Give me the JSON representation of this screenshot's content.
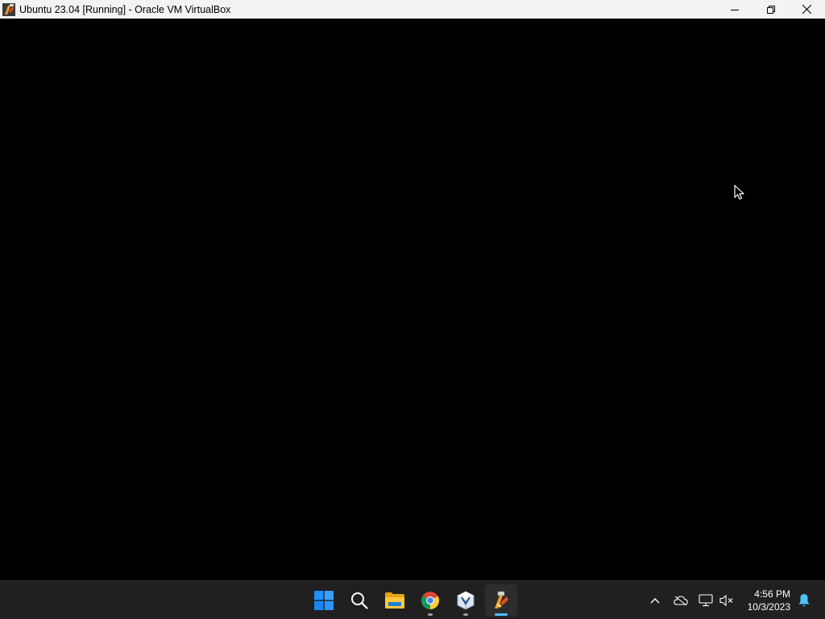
{
  "window": {
    "title": "Ubuntu 23.04 [Running] - Oracle VM VirtualBox",
    "icon": "virtualbox-vm-icon",
    "controls": [
      "minimize-icon",
      "restore-icon",
      "close-icon"
    ]
  },
  "vm_display": {
    "content": "",
    "background": "#000000"
  },
  "taskbar": {
    "background": "#202020",
    "pinned": [
      {
        "name": "start",
        "icon": "windows-logo-icon",
        "running": false,
        "active": false
      },
      {
        "name": "search",
        "icon": "search-icon",
        "running": false,
        "active": false
      },
      {
        "name": "file-explorer",
        "icon": "folder-icon",
        "running": false,
        "active": false
      },
      {
        "name": "chrome",
        "icon": "chrome-icon",
        "running": true,
        "active": false
      },
      {
        "name": "virtualbox-manager",
        "icon": "virtualbox-icon",
        "running": true,
        "active": false
      },
      {
        "name": "ubuntu-vm",
        "icon": "virtualbox-vm-icon",
        "running": true,
        "active": true
      }
    ],
    "tray": {
      "icons": [
        "chevron-up-icon",
        "onedrive-offline-icon",
        "network-icon",
        "volume-muted-icon",
        "notification-bell-icon"
      ],
      "time": "4:56 PM",
      "date": "10/3/2023",
      "accent": "#4cc2ff"
    }
  }
}
